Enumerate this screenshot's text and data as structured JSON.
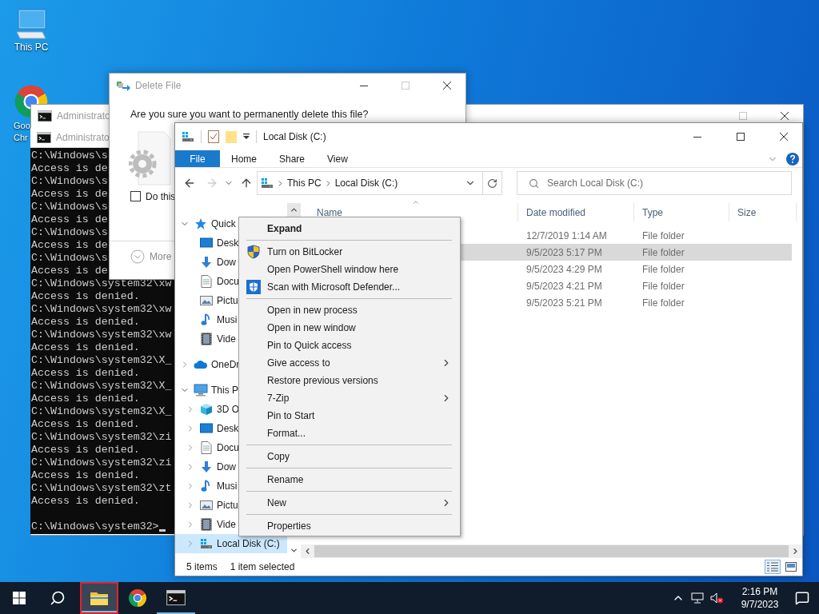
{
  "desktop_icons": [
    {
      "kind": "pc",
      "label_lines": [
        "This PC"
      ]
    },
    {
      "kind": "chrome",
      "label_lines": [
        "Goo",
        "Chr"
      ]
    }
  ],
  "cmd_back": {
    "title": "Administrato"
  },
  "cmd_front": {
    "title": "Administrato",
    "prompt": "C:\\Windows\\system32>",
    "lines": [
      "C:\\Windows\\s",
      "Access is de",
      "C:\\Windows\\s",
      "Access is de",
      "C:\\Windows\\s",
      "Access is de",
      "C:\\Windows\\s",
      "Access is de",
      "C:\\Windows\\s",
      "Access is de",
      "C:\\Windows\\system32\\xw",
      "Access is denied.",
      "C:\\Windows\\system32\\xw",
      "Access is denied.",
      "C:\\Windows\\system32\\xw",
      "Access is denied.",
      "C:\\Windows\\system32\\X_",
      "Access is denied.",
      "C:\\Windows\\system32\\X_",
      "Access is denied.",
      "C:\\Windows\\system32\\X_",
      "Access is denied.",
      "C:\\Windows\\system32\\zi",
      "Access is denied.",
      "C:\\Windows\\system32\\zi",
      "Access is denied.",
      "C:\\Windows\\system32\\zt",
      "Access is denied."
    ]
  },
  "delete_dialog": {
    "title": "Delete File",
    "question": "Are you sure you want to permanently delete this file?",
    "checkbox": {
      "label": "Do this",
      "checked": false
    },
    "more": "More",
    "window_buttons": [
      {
        "kind": "minimize",
        "disabled": false
      },
      {
        "kind": "maximize",
        "disabled": true
      },
      {
        "kind": "close",
        "disabled": false
      }
    ]
  },
  "explorer": {
    "title": "Local Disk (C:)",
    "ribbon_tabs": [
      {
        "label": "File",
        "kind": "file"
      },
      {
        "label": "Home",
        "kind": "tab"
      },
      {
        "label": "Share",
        "kind": "tab"
      },
      {
        "label": "View",
        "kind": "tab"
      }
    ],
    "address": [
      "This PC",
      "Local Disk (C:)"
    ],
    "search_placeholder": "Search Local Disk (C:)",
    "tree": [
      {
        "label": "Quick",
        "kind": "quick",
        "expanded": true,
        "selected": false,
        "children": [
          {
            "label": "Desk",
            "kind": "desktop",
            "selected": false
          },
          {
            "label": "Dow",
            "kind": "downloads",
            "selected": false
          },
          {
            "label": "Docu",
            "kind": "documents",
            "selected": false
          },
          {
            "label": "Pictu",
            "kind": "pictures",
            "selected": false
          },
          {
            "label": "Musi",
            "kind": "music",
            "selected": false
          },
          {
            "label": "Vide",
            "kind": "videos",
            "selected": false
          }
        ]
      },
      {
        "label": "OneDr",
        "kind": "onedrive",
        "expanded": false,
        "selected": false
      },
      {
        "label": "This P",
        "kind": "pc",
        "expanded": true,
        "selected": false,
        "children": [
          {
            "label": "3D O",
            "kind": "objects3d",
            "expanded": false,
            "selected": false
          },
          {
            "label": "Desk",
            "kind": "desktop",
            "expanded": false,
            "selected": false
          },
          {
            "label": "Docu",
            "kind": "documents",
            "expanded": false,
            "selected": false
          },
          {
            "label": "Dow",
            "kind": "downloads",
            "expanded": false,
            "selected": false
          },
          {
            "label": "Musi",
            "kind": "music",
            "expanded": false,
            "selected": false
          },
          {
            "label": "Pictu",
            "kind": "pictures",
            "expanded": false,
            "selected": false
          },
          {
            "label": "Vide",
            "kind": "videos",
            "expanded": false,
            "selected": false
          },
          {
            "label": "Local Disk (C:)",
            "kind": "drive",
            "expanded": false,
            "selected": true
          }
        ]
      }
    ],
    "columns": [
      "Name",
      "Date modified",
      "Type",
      "Size"
    ],
    "rows": [
      {
        "date_modified": "12/7/2019 1:14 AM",
        "type": "File folder",
        "selected": false
      },
      {
        "date_modified": "9/5/2023 5:17 PM",
        "type": "File folder",
        "selected": true
      },
      {
        "date_modified": "9/5/2023 4:29 PM",
        "type": "File folder",
        "selected": false
      },
      {
        "date_modified": "9/5/2023 4:21 PM",
        "type": "File folder",
        "selected": false
      },
      {
        "date_modified": "9/5/2023 5:21 PM",
        "type": "File folder",
        "selected": false
      }
    ],
    "status": {
      "items": "5 items",
      "selection": "1 item selected"
    },
    "views": [
      {
        "kind": "details",
        "selected": true
      },
      {
        "kind": "tiles",
        "selected": false
      }
    ]
  },
  "context_menu": {
    "groups": [
      [
        {
          "label": "Expand",
          "kind": "bold",
          "submenu": false
        }
      ],
      [
        {
          "label": "Turn on BitLocker",
          "kind": "shield",
          "submenu": false
        },
        {
          "label": "Open PowerShell window here",
          "kind": "plain",
          "submenu": false
        },
        {
          "label": "Scan with Microsoft Defender...",
          "kind": "defender",
          "submenu": false
        }
      ],
      [
        {
          "label": "Open in new process",
          "kind": "plain",
          "submenu": false
        },
        {
          "label": "Open in new window",
          "kind": "plain",
          "submenu": false
        },
        {
          "label": "Pin to Quick access",
          "kind": "plain",
          "submenu": false
        },
        {
          "label": "Give access to",
          "kind": "plain",
          "submenu": true
        },
        {
          "label": "Restore previous versions",
          "kind": "plain",
          "submenu": false
        },
        {
          "label": "7-Zip",
          "kind": "plain",
          "submenu": true
        },
        {
          "label": "Pin to Start",
          "kind": "plain",
          "submenu": false
        },
        {
          "label": "Format...",
          "kind": "plain",
          "submenu": false
        }
      ],
      [
        {
          "label": "Copy",
          "kind": "plain",
          "submenu": false
        }
      ],
      [
        {
          "label": "Rename",
          "kind": "plain",
          "submenu": false
        }
      ],
      [
        {
          "label": "New",
          "kind": "plain",
          "submenu": true
        }
      ],
      [
        {
          "label": "Properties",
          "kind": "plain",
          "submenu": false
        }
      ]
    ]
  },
  "taskbar": {
    "apps": [
      {
        "kind": "explorer",
        "active": true,
        "running": true
      },
      {
        "kind": "chrome",
        "active": false,
        "running": false
      },
      {
        "kind": "console",
        "active": false,
        "running": true
      }
    ],
    "time": "2:16 PM",
    "date": "9/7/2023"
  }
}
